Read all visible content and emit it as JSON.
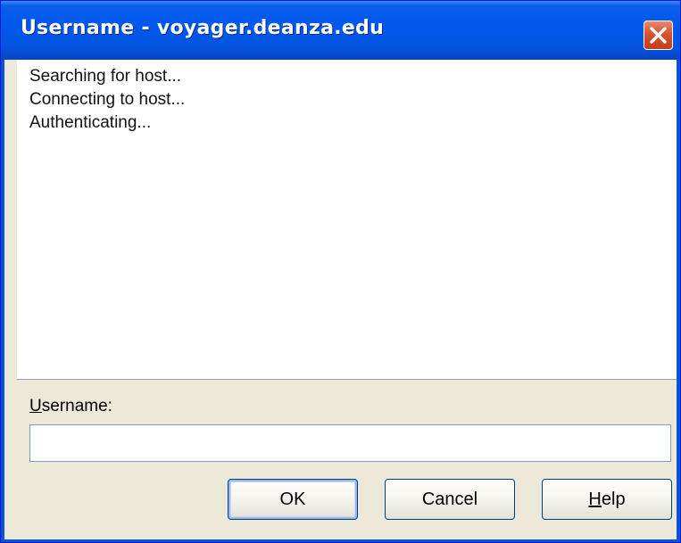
{
  "window": {
    "title": "Username - voyager.deanza.edu",
    "close_icon": "close-icon"
  },
  "log": {
    "lines": [
      "Searching for host...",
      "Connecting to host...",
      "Authenticating..."
    ]
  },
  "form": {
    "username_label_mnemonic": "U",
    "username_label_rest": "sername:",
    "username_value": ""
  },
  "buttons": {
    "ok_label": "OK",
    "cancel_label": "Cancel",
    "help_mnemonic": "H",
    "help_rest": "elp"
  },
  "colors": {
    "titlebar": "#0058ee",
    "close_button": "#d8532c",
    "dialog_face": "#ece9d8"
  }
}
